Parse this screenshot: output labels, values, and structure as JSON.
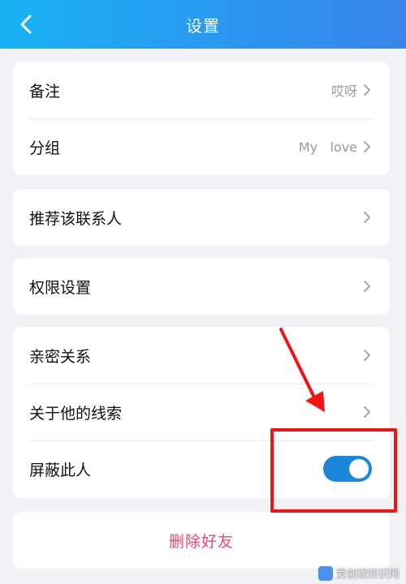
{
  "header": {
    "title": "设置",
    "back_icon": "chevron-left-icon"
  },
  "card1": {
    "remark": {
      "label": "备注",
      "value": "哎呀"
    },
    "group": {
      "label": "分组",
      "value": "My   love"
    }
  },
  "recommend": {
    "label": "推荐该联系人"
  },
  "permission": {
    "label": "权限设置"
  },
  "card4": {
    "intimacy": {
      "label": "亲密关系"
    },
    "clues": {
      "label": "关于他的线索"
    },
    "block": {
      "label": "屏蔽此人",
      "toggle_on": true
    }
  },
  "delete_friend": {
    "label": "删除好友"
  },
  "watermark": {
    "text": "爱创根知识网"
  },
  "colors": {
    "header_start": "#19b3f4",
    "header_end": "#3a86ee",
    "toggle": "#1c86d9",
    "delete": "#e84a6f",
    "annotation": "#f01414"
  }
}
